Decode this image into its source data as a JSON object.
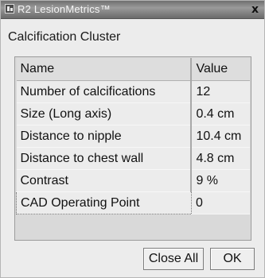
{
  "window": {
    "title": "R2 LesionMetrics™",
    "close_glyph": "x"
  },
  "dialog": {
    "heading": "Calcification Cluster"
  },
  "table": {
    "columns": [
      "Name",
      "Value"
    ],
    "rows": [
      {
        "name": "Number of calcifications",
        "value": "12"
      },
      {
        "name": "Size (Long axis)",
        "value": "0.4 cm"
      },
      {
        "name": "Distance to nipple",
        "value": "10.4 cm"
      },
      {
        "name": "Distance to chest wall",
        "value": "4.8 cm"
      },
      {
        "name": "Contrast",
        "value": "9 %"
      },
      {
        "name": "CAD Operating Point",
        "value": "0"
      }
    ]
  },
  "buttons": {
    "close_all": "Close All",
    "ok": "OK"
  }
}
